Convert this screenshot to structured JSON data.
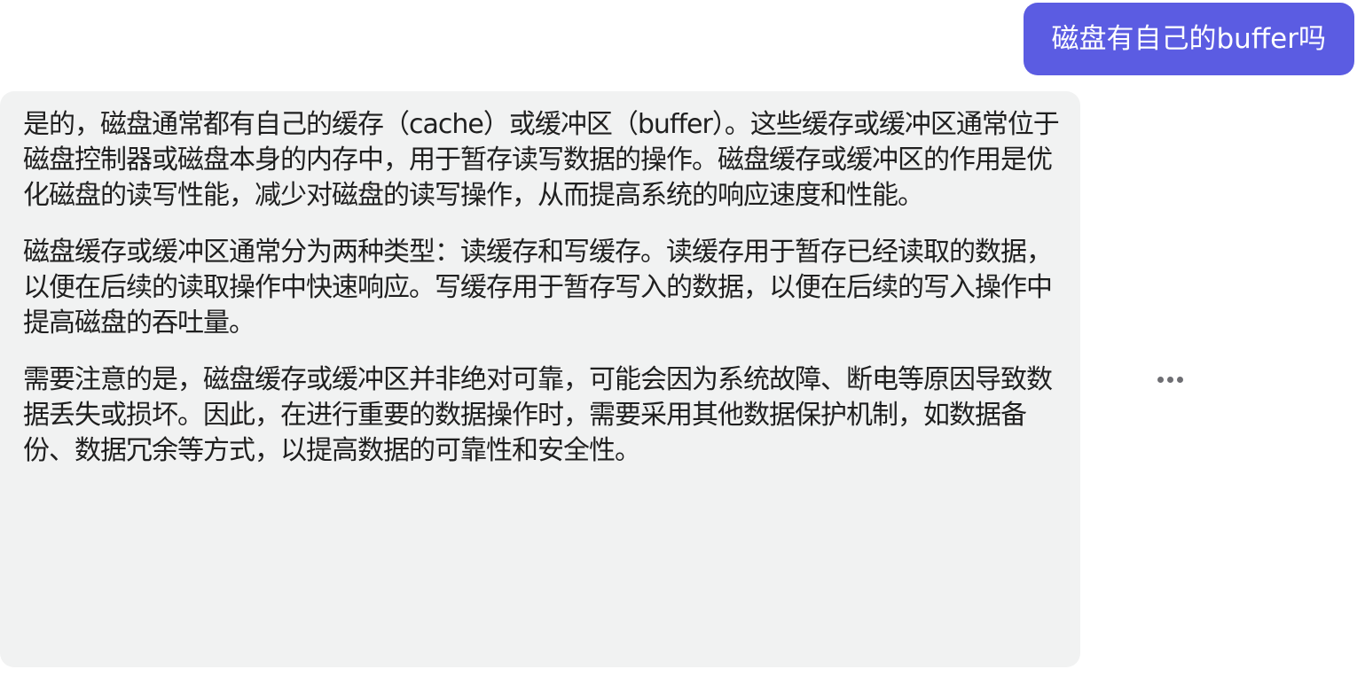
{
  "user_message": {
    "text": "磁盘有自己的buffer吗"
  },
  "assistant_message": {
    "paragraphs": [
      "是的，磁盘通常都有自己的缓存（cache）或缓冲区（buffer）。这些缓存或缓冲区通常位于磁盘控制器或磁盘本身的内存中，用于暂存读写数据的操作。磁盘缓存或缓冲区的作用是优化磁盘的读写性能，减少对磁盘的读写操作，从而提高系统的响应速度和性能。",
      "磁盘缓存或缓冲区通常分为两种类型：读缓存和写缓存。读缓存用于暂存已经读取的数据，以便在后续的读取操作中快速响应。写缓存用于暂存写入的数据，以便在后续的写入操作中提高磁盘的吞吐量。",
      "需要注意的是，磁盘缓存或缓冲区并非绝对可靠，可能会因为系统故障、断电等原因导致数据丢失或损坏。因此，在进行重要的数据操作时，需要采用其他数据保护机制，如数据备份、数据冗余等方式，以提高数据的可靠性和安全性。"
    ]
  },
  "actions": {
    "more_icon": "more-horizontal-icon"
  },
  "colors": {
    "user_bubble_bg": "#5b5ce2",
    "assistant_bubble_bg": "#f1f2f2",
    "text": "#1f1f1f"
  }
}
